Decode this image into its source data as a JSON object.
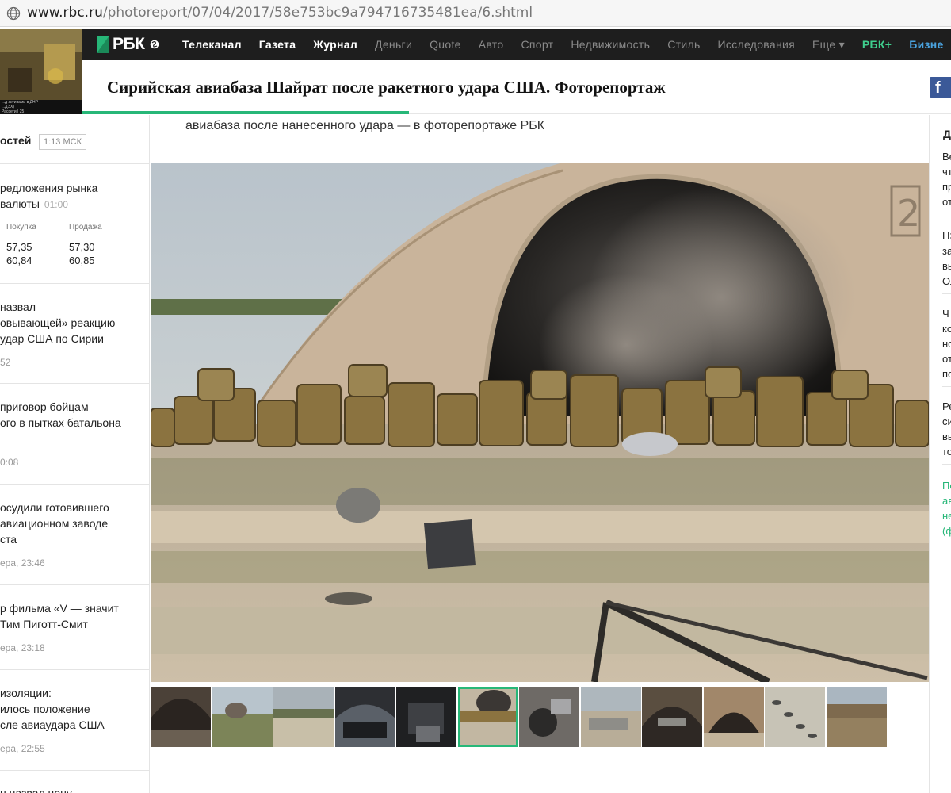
{
  "browser": {
    "url_domain": "www.rbc.ru",
    "url_path": "/photoreport/07/04/2017/58e753bc9a794716735481ea/6.shtml"
  },
  "promo": {
    "ticker": [
      "...д активами в ДНР",
      "...ДЭХ)",
      "...раделениями нет (Fox News)",
      "Рассети | 25"
    ]
  },
  "header": {
    "logo_text": "РБК",
    "nav": [
      {
        "label": "Телеканал",
        "style": "strong"
      },
      {
        "label": "Газета",
        "style": "strong"
      },
      {
        "label": "Журнал",
        "style": "strong"
      },
      {
        "label": "Деньги",
        "style": "dim"
      },
      {
        "label": "Quote",
        "style": "dim"
      },
      {
        "label": "Авто",
        "style": "dim"
      },
      {
        "label": "Спорт",
        "style": "dim"
      },
      {
        "label": "Недвижимость",
        "style": "dim"
      },
      {
        "label": "Стиль",
        "style": "dim"
      },
      {
        "label": "Исследования",
        "style": "dim"
      },
      {
        "label": "Еще ▾",
        "style": "dim"
      },
      {
        "label": "РБК+",
        "style": "green"
      },
      {
        "label": "Бизне",
        "style": "blue"
      }
    ]
  },
  "article": {
    "title": "Сирийская авиабаза Шайрат после ракетного удара США. Фоторепортаж",
    "lead": "авиабаза после нанесенного удара — в фоторепортаже РБК"
  },
  "left_sidebar": {
    "header": "остей",
    "time_badge": "1:13 МСК",
    "fx": {
      "title_lines": "редложения рынка\nвалюты",
      "time": "01:00",
      "buy_label": "Покупка",
      "sell_label": "Продажа",
      "buy_values": "57,35\n60,84",
      "sell_values": "57,30\n60,85"
    },
    "news": [
      {
        "text": " назвал\nовывающей» реакцию\nудар США по Сирии",
        "time": "52"
      },
      {
        "text": "приговор бойцам\nого в пытках батальона",
        "time": "0:08"
      },
      {
        "text": "осудили готовившего\nавиационном заводе\nста",
        "time": "ера, 23:46"
      },
      {
        "text": "р фильма «V — значит\nТим Пиготт-Смит",
        "time": "ера, 23:18"
      },
      {
        "text": "изоляции:\nилось положение\nсле авиаудара США",
        "time": "ера, 22:55"
      },
      {
        "text": "н назвал цену",
        "time": ""
      }
    ]
  },
  "right_sidebar": {
    "header": "Д",
    "items": [
      {
        "text": "Ве\nчт\nпр\nот",
        "style": "normal"
      },
      {
        "text": "НЭ\nза\nвы\nОл",
        "style": "normal"
      },
      {
        "text": "Чт\nко\nно\nот\nпо",
        "style": "normal"
      },
      {
        "text": "Ре\nси\nвы\nто",
        "style": "normal"
      },
      {
        "text": "По\nав\nне\n(ф",
        "style": "green"
      }
    ]
  },
  "gallery": {
    "active_index": 5,
    "count": 12
  },
  "colors": {
    "accent": "#27b778",
    "nav_bg": "#1e1e1e",
    "facebook": "#3b5998"
  }
}
